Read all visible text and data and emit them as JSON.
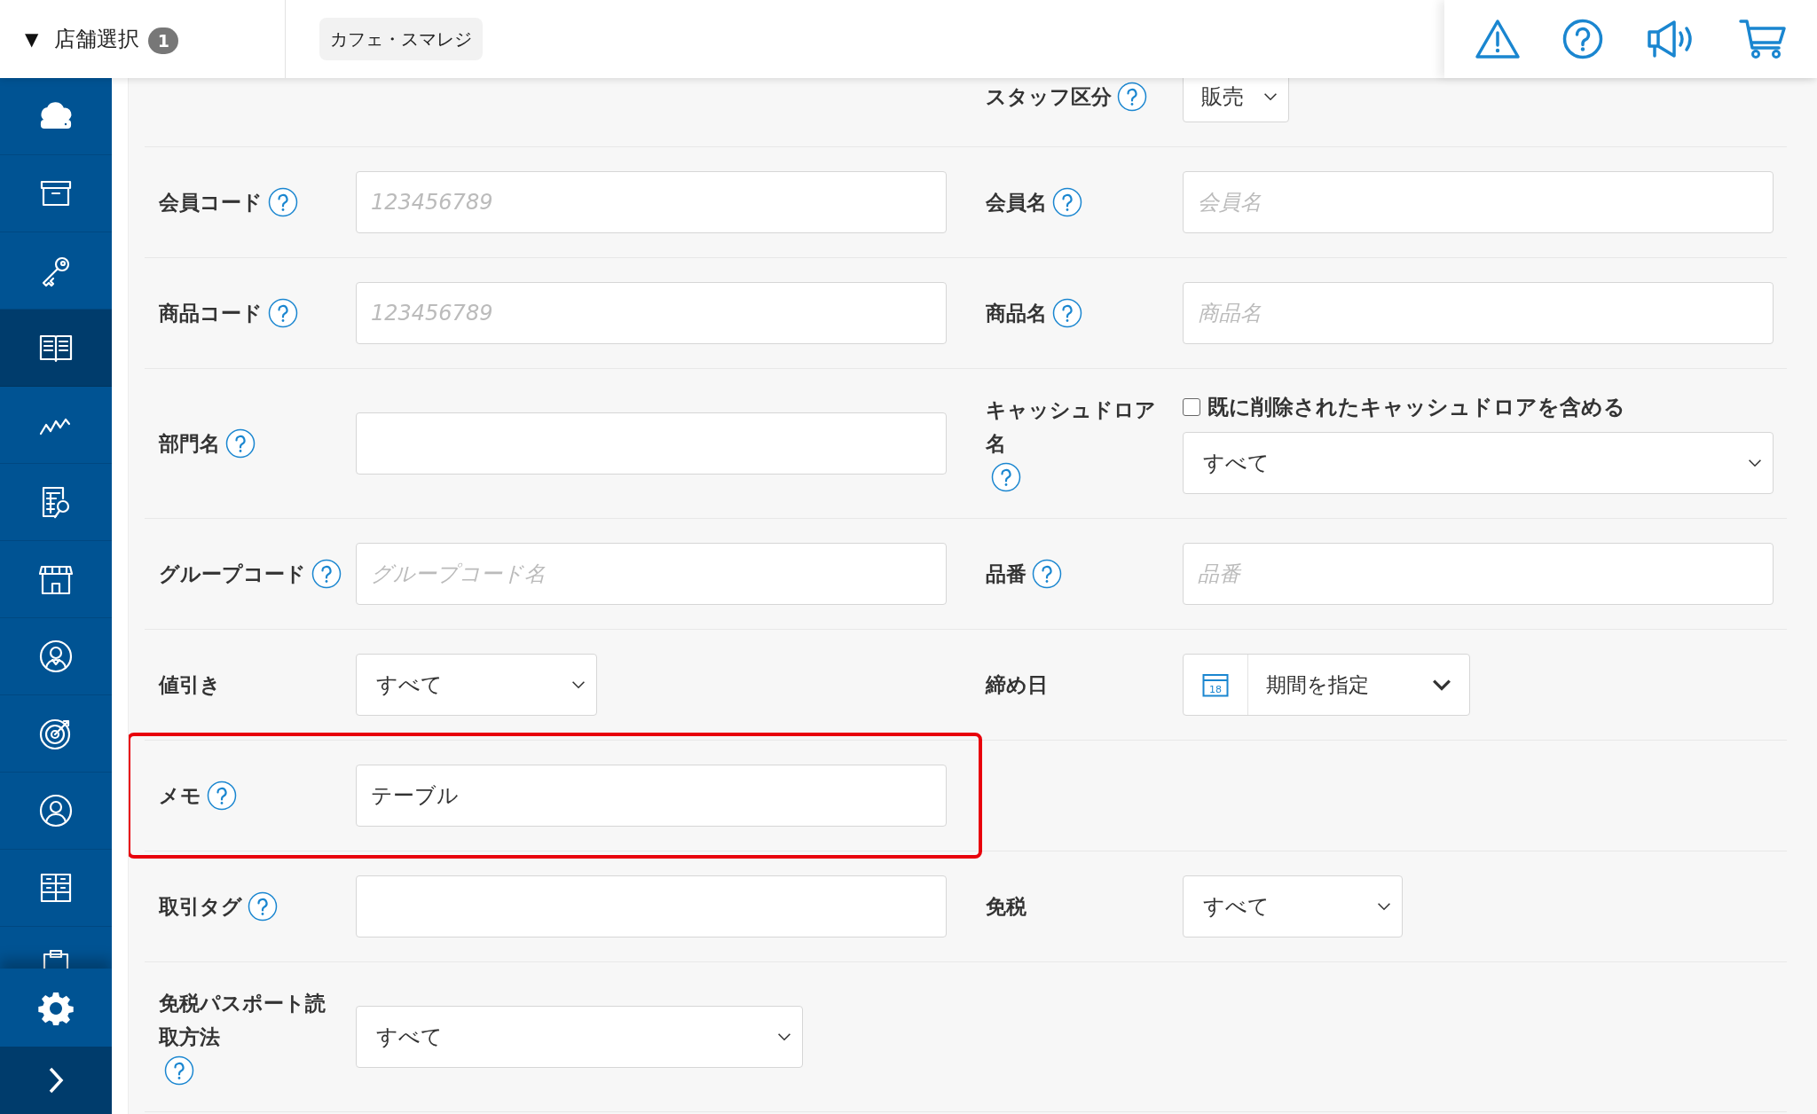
{
  "header": {
    "store_toggle": "▼",
    "store_label": "店舗選択",
    "store_count": "1",
    "store_chip": "カフェ・スマレジ"
  },
  "sidebar": {
    "items": [
      {
        "kind": "cloud",
        "selected": false
      },
      {
        "kind": "archive",
        "selected": false
      },
      {
        "kind": "key",
        "selected": false
      },
      {
        "kind": "book",
        "selected": true
      },
      {
        "kind": "chart",
        "selected": false
      },
      {
        "kind": "report",
        "selected": false
      },
      {
        "kind": "store",
        "selected": false
      },
      {
        "kind": "staff",
        "selected": false
      },
      {
        "kind": "target",
        "selected": false
      },
      {
        "kind": "member",
        "selected": false
      },
      {
        "kind": "grid",
        "selected": false
      },
      {
        "kind": "clipboard",
        "selected": false
      }
    ]
  },
  "form": {
    "rows": [
      {
        "highlighted": false,
        "right": {
          "kind": "select",
          "label": "スタッフ区分",
          "help": true,
          "value": "販売"
        }
      },
      {
        "highlighted": false,
        "left": {
          "kind": "text",
          "label": "会員コード",
          "help": true,
          "placeholder": "123456789"
        },
        "right": {
          "kind": "text",
          "label": "会員名",
          "help": true,
          "placeholder": "会員名"
        }
      },
      {
        "highlighted": false,
        "left": {
          "kind": "text",
          "label": "商品コード",
          "help": true,
          "placeholder": "123456789"
        },
        "right": {
          "kind": "text",
          "label": "商品名",
          "help": true,
          "placeholder": "商品名"
        }
      },
      {
        "highlighted": false,
        "left": {
          "kind": "text",
          "label": "部門名",
          "help": true
        },
        "right": {
          "kind": "check-select",
          "label": "キャッシュドロア名",
          "help": true,
          "check_label": "既に削除されたキャッシュドロアを含める",
          "checked": false,
          "value": "すべて"
        }
      },
      {
        "highlighted": false,
        "left": {
          "kind": "text",
          "label": "グループコード",
          "help": true,
          "placeholder": "グループコード名"
        },
        "right": {
          "kind": "text",
          "label": "品番",
          "help": true,
          "placeholder": "品番"
        }
      },
      {
        "highlighted": false,
        "left": {
          "kind": "select",
          "label": "値引き",
          "help": false,
          "value": "すべて"
        },
        "right": {
          "kind": "date",
          "label": "締め日",
          "help": false,
          "value": "期間を指定",
          "day": "18"
        }
      },
      {
        "highlighted": true,
        "left": {
          "kind": "text",
          "label": "メモ",
          "help": true,
          "value": "テーブル"
        }
      },
      {
        "highlighted": false,
        "left": {
          "kind": "text",
          "label": "取引タグ",
          "help": true
        },
        "right": {
          "kind": "select",
          "label": "免税",
          "help": false,
          "value": "すべて"
        }
      },
      {
        "highlighted": false,
        "left": {
          "kind": "select",
          "label": "免税パスポート読取方法",
          "help": true,
          "value": "すべて"
        }
      }
    ]
  }
}
